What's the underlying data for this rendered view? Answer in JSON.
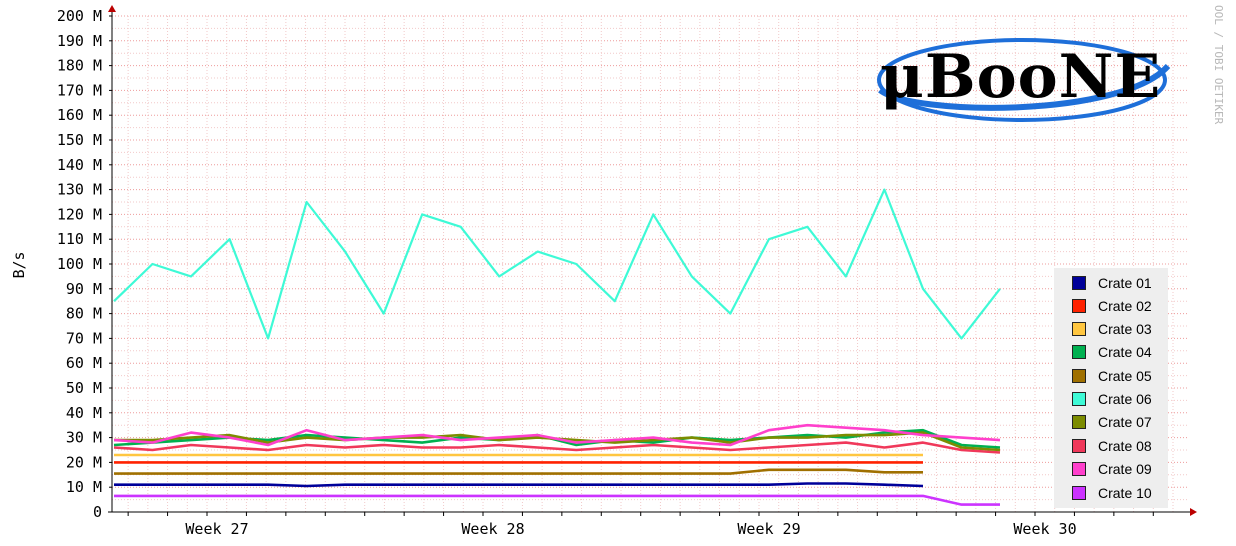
{
  "chart_data": {
    "type": "line",
    "ylabel": "B/s",
    "ylim": [
      0,
      200000000
    ],
    "y_ticks": [
      "0",
      "10 M",
      "20 M",
      "30 M",
      "40 M",
      "50 M",
      "60 M",
      "70 M",
      "80 M",
      "90 M",
      "100 M",
      "110 M",
      "120 M",
      "130 M",
      "140 M",
      "150 M",
      "160 M",
      "170 M",
      "180 M",
      "190 M",
      "200 M"
    ],
    "x_ticks": [
      "Week 27",
      "Week 28",
      "Week 29",
      "Week 30"
    ],
    "grid": true,
    "legend_position": "right",
    "series": [
      {
        "name": "Crate 01",
        "color": "#000099",
        "values": [
          11,
          11,
          11,
          11,
          11,
          10.5,
          11,
          11,
          11,
          11,
          11,
          11,
          11,
          11,
          11,
          11,
          11,
          11,
          11.5,
          11.5,
          11,
          10.5,
          null,
          null
        ]
      },
      {
        "name": "Crate 02",
        "color": "#ff2200",
        "values": [
          20,
          20,
          20,
          20,
          20,
          20,
          20,
          20,
          20,
          20,
          20,
          20,
          20,
          20,
          20,
          20,
          20,
          20,
          20,
          20,
          20,
          20,
          null,
          null
        ]
      },
      {
        "name": "Crate 03",
        "color": "#ffc640",
        "values": [
          23,
          23,
          23,
          23,
          23,
          23,
          23,
          23,
          23,
          23,
          23,
          23,
          23,
          23,
          23,
          23,
          23,
          23,
          23,
          23,
          23,
          23,
          null,
          null
        ]
      },
      {
        "name": "Crate 04",
        "color": "#00b050",
        "values": [
          27,
          28,
          29,
          30,
          29,
          31,
          30,
          29,
          28,
          30,
          29,
          31,
          27,
          29,
          28,
          30,
          29,
          30,
          31,
          30,
          32,
          33,
          27,
          26
        ]
      },
      {
        "name": "Crate 05",
        "color": "#a07000",
        "values": [
          15.5,
          15.5,
          15.5,
          15.5,
          15.5,
          15.5,
          15.5,
          15.5,
          15.5,
          15.5,
          15.5,
          15.5,
          15.5,
          15.5,
          15.5,
          15.5,
          15.5,
          17,
          17,
          17,
          16,
          16,
          null,
          null
        ]
      },
      {
        "name": "Crate 06",
        "color": "#3efad6",
        "values": [
          85,
          100,
          95,
          110,
          70,
          125,
          105,
          80,
          120,
          115,
          95,
          105,
          100,
          85,
          120,
          95,
          80,
          110,
          115,
          95,
          130,
          90,
          70,
          90
        ]
      },
      {
        "name": "Crate 07",
        "color": "#7c8c00",
        "values": [
          29,
          29,
          30,
          31,
          28,
          30,
          29,
          30,
          30,
          31,
          29,
          30,
          29,
          28,
          29,
          30,
          28,
          30,
          30,
          31,
          31,
          32,
          26,
          25
        ]
      },
      {
        "name": "Crate 08",
        "color": "#f0385a",
        "values": [
          26,
          25,
          27,
          26,
          25,
          27,
          26,
          27,
          26,
          26,
          27,
          26,
          25,
          26,
          27,
          26,
          25,
          26,
          27,
          28,
          26,
          28,
          25,
          24
        ]
      },
      {
        "name": "Crate 09",
        "color": "#ff40cc",
        "values": [
          29,
          28,
          32,
          30,
          27,
          33,
          29,
          30,
          31,
          29,
          30,
          31,
          28,
          29,
          30,
          28,
          27,
          33,
          35,
          34,
          33,
          31,
          30,
          29
        ]
      },
      {
        "name": "Crate 10",
        "color": "#cc33ff",
        "values": [
          6.5,
          6.5,
          6.5,
          6.5,
          6.5,
          6.5,
          6.5,
          6.5,
          6.5,
          6.5,
          6.5,
          6.5,
          6.5,
          6.5,
          6.5,
          6.5,
          6.5,
          6.5,
          6.5,
          6.5,
          6.5,
          6.5,
          3,
          3
        ]
      }
    ]
  },
  "legend": {
    "items": [
      "Crate 01",
      "Crate 02",
      "Crate 03",
      "Crate 04",
      "Crate 05",
      "Crate 06",
      "Crate 07",
      "Crate 08",
      "Crate 09",
      "Crate 10"
    ],
    "colors": [
      "#000099",
      "#ff2200",
      "#ffc640",
      "#00b050",
      "#a07000",
      "#3efad6",
      "#7c8c00",
      "#f0385a",
      "#ff40cc",
      "#cc33ff"
    ]
  },
  "logo": {
    "text": "μBooNE",
    "ring_color": "#1e6fd9"
  },
  "side_text": "OOL / TOBI OETIKER"
}
